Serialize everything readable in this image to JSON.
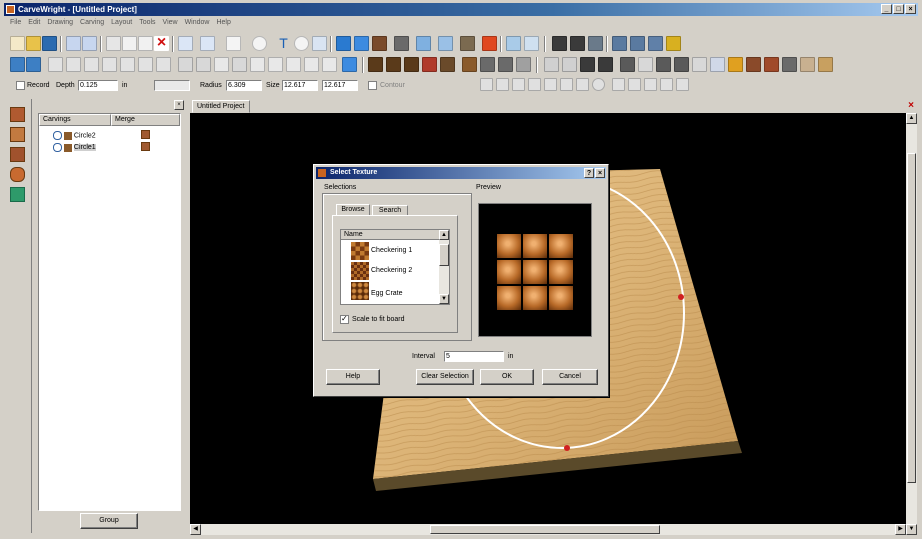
{
  "window": {
    "title": "CarveWright - [Untitled Project]",
    "min": "_",
    "max": "□",
    "close": "×"
  },
  "menu": [
    "File",
    "Edit",
    "Drawing",
    "Carving",
    "Layout",
    "Tools",
    "View",
    "Window",
    "Help"
  ],
  "toolbar": {
    "record_label": "Record",
    "depth_label": "Depth",
    "depth_value": "0.125",
    "in_label": "in",
    "radius_label": "Radius",
    "radius_value": "6.309",
    "size_label": "Size",
    "size_w": "12.617",
    "size_h": "12.617",
    "contour_label": "Contour"
  },
  "panel": {
    "col_carvings": "Carvings",
    "col_merge": "Merge",
    "items": [
      "Circle2",
      "Circle1"
    ],
    "group_button": "Group"
  },
  "viewport": {
    "tab_label": "Untitled Project"
  },
  "dialog": {
    "title": "Select Texture",
    "help": "?",
    "close": "×",
    "selections_label": "Selections",
    "preview_label": "Preview",
    "tab_browse": "Browse",
    "tab_search": "Search",
    "list_header": "Name",
    "list_items": [
      "Checkering 1",
      "Checkering 2",
      "Egg Crate"
    ],
    "scale_label": "Scale to fit board",
    "interval_label": "Interval",
    "interval_value": "5",
    "interval_unit": "in",
    "btn_help": "Help",
    "btn_clear": "Clear Selection",
    "btn_ok": "OK",
    "btn_cancel": "Cancel"
  }
}
